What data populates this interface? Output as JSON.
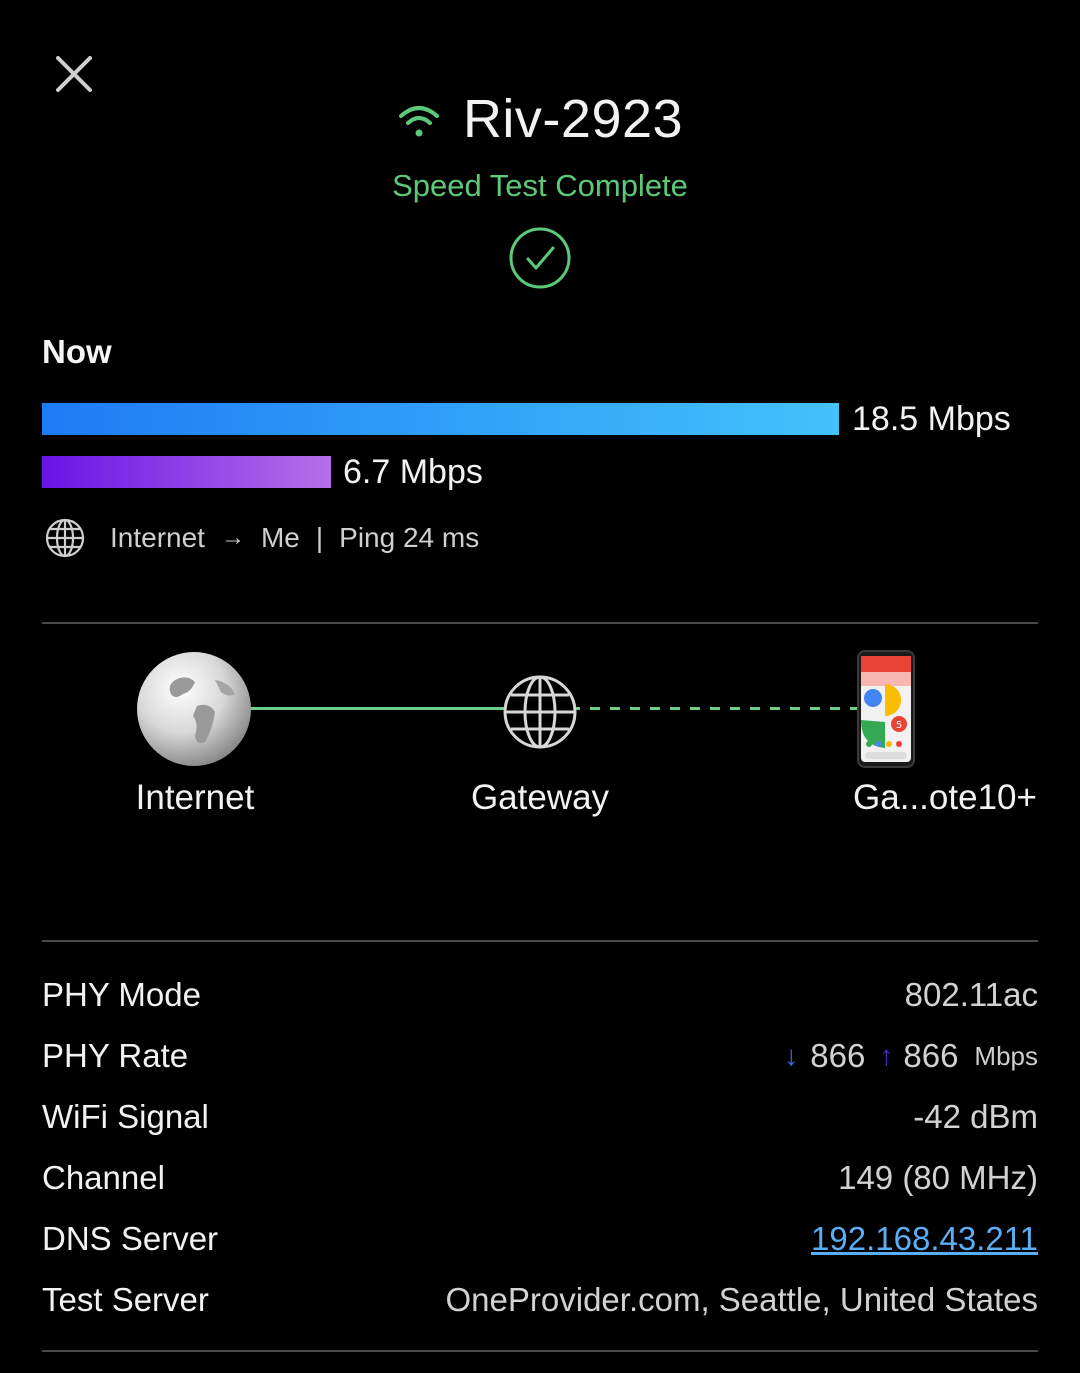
{
  "header": {
    "network_name": "Riv-2923",
    "status": "Speed Test Complete",
    "accent_color": "#5cc979"
  },
  "now": {
    "label": "Now",
    "download": {
      "value": 18.5,
      "text": "18.5 Mbps",
      "fill_fraction": 0.8
    },
    "upload": {
      "value": 6.7,
      "text": "6.7 Mbps",
      "fill_fraction": 0.29
    },
    "route": {
      "from": "Internet",
      "to": "Me",
      "ping": "Ping 24 ms"
    }
  },
  "topology": {
    "internet": "Internet",
    "gateway": "Gateway",
    "device": "Ga...ote10+"
  },
  "details": {
    "phy_mode": {
      "label": "PHY Mode",
      "value": "802.11ac"
    },
    "phy_rate": {
      "label": "PHY Rate",
      "down": "866",
      "up": "866",
      "unit": "Mbps"
    },
    "wifi_signal": {
      "label": "WiFi Signal",
      "value": "-42 dBm"
    },
    "channel": {
      "label": "Channel",
      "value": "149 (80 MHz)"
    },
    "dns_server": {
      "label": "DNS Server",
      "value": "192.168.43.211"
    },
    "test_server": {
      "label": "Test Server",
      "value": "OneProvider.com, Seattle, United States"
    }
  },
  "icons": [
    "close-icon",
    "wifi-icon",
    "check-circle-icon",
    "globe-icon",
    "earth-icon",
    "gateway-icon",
    "phone-icon",
    "arrow-right-icon",
    "arrow-down-icon",
    "arrow-up-icon"
  ]
}
